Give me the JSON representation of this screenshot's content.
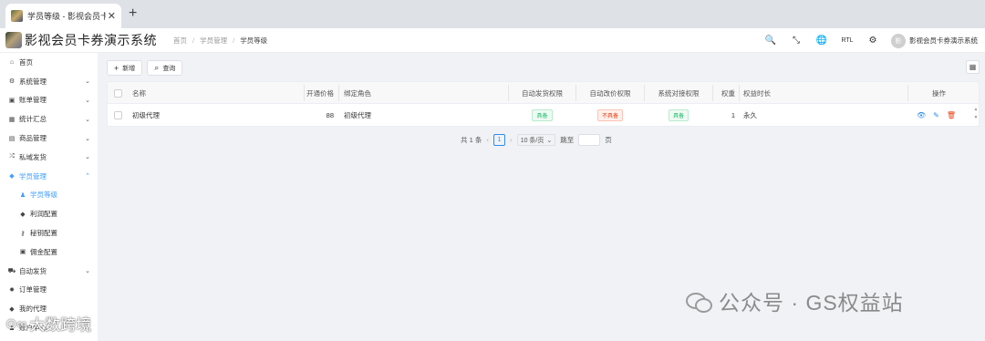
{
  "browser": {
    "tab_title": "学员等级 - 影视会员卡券演示系统",
    "tab_close": "✕",
    "new_tab": "+"
  },
  "header": {
    "app_title": "影视会员卡券演示系统",
    "breadcrumb": [
      "首页",
      "学员管理",
      "学员等级"
    ],
    "breadcrumb_sep": "/",
    "tools": {
      "search": "🔍",
      "fullscreen": "⤡",
      "language": "🌐",
      "rtl": "RTL",
      "settings": "⚙"
    },
    "user": {
      "avatar": "影",
      "name": "影视会员卡券演示系统"
    }
  },
  "sidebar": {
    "items": [
      {
        "icon": "home-icon",
        "glyph": "⌂",
        "label": "首页",
        "chevron": ""
      },
      {
        "icon": "gears-icon",
        "glyph": "⚙",
        "label": "系统管理",
        "chevron": "⌄"
      },
      {
        "icon": "bill-icon",
        "glyph": "▣",
        "label": "账单管理",
        "chevron": "⌄"
      },
      {
        "icon": "stats-icon",
        "glyph": "▦",
        "label": "统计汇总",
        "chevron": "⌄"
      },
      {
        "icon": "calendar-icon",
        "glyph": "▤",
        "label": "商品管理",
        "chevron": "⌄"
      },
      {
        "icon": "shuffle-icon",
        "glyph": "⤮",
        "label": "私域发货",
        "chevron": "⌄"
      },
      {
        "icon": "tag-icon",
        "glyph": "◆",
        "label": "学员管理",
        "chevron": "⌃"
      },
      {
        "icon": "user-icon",
        "glyph": "♟",
        "label": "学员等级",
        "chevron": ""
      },
      {
        "icon": "tag-icon",
        "glyph": "◆",
        "label": "利润配置",
        "chevron": ""
      },
      {
        "icon": "key-icon",
        "glyph": "⚷",
        "label": "秘钥配置",
        "chevron": ""
      },
      {
        "icon": "money-icon",
        "glyph": "▣",
        "label": "佣金配置",
        "chevron": ""
      },
      {
        "icon": "car-icon",
        "glyph": "⛟",
        "label": "自动发货",
        "chevron": "⌄"
      },
      {
        "icon": "gear-icon",
        "glyph": "✹",
        "label": "订单管理",
        "chevron": ""
      },
      {
        "icon": "tag-icon",
        "glyph": "◆",
        "label": "我的代理",
        "chevron": ""
      },
      {
        "icon": "user-icon",
        "glyph": "♟",
        "label": "账户中心",
        "chevron": ""
      }
    ]
  },
  "toolbar": {
    "add_label": "新增",
    "add_glyph": "+",
    "query_label": "查询",
    "query_glyph": "⌕",
    "grid_glyph": "▦"
  },
  "table": {
    "columns": {
      "name": "名称",
      "price": "开通价格",
      "role": "绑定角色",
      "auto_ship": "自动发货权限",
      "auto_price": "自动改价权限",
      "sys_dock": "系统对接权限",
      "weight": "权重",
      "duration": "权益时长",
      "ops": "操作"
    },
    "rows": [
      {
        "name": "初级代理",
        "price": "88",
        "role": "初级代理",
        "auto_ship": "具备",
        "auto_price": "不具备",
        "sys_dock": "具备",
        "weight": "1",
        "duration": "永久"
      }
    ],
    "actions": {
      "view": "👁",
      "edit": "✎",
      "delete": "🗑"
    }
  },
  "pagination": {
    "total": "共 1 条",
    "prev": "‹",
    "current": "1",
    "next": "›",
    "page_size": "10 条/页",
    "page_size_chevron": "⌄",
    "jump_label": "跳至",
    "page_suffix": "页"
  },
  "watermarks": {
    "right": "公众号 · GS权益站",
    "left": "大数跨境",
    "left_glyph": "⊙∞"
  },
  "colors": {
    "primary": "#409eff",
    "success": "#19be6b",
    "danger": "#ed4014",
    "link": "#2d8cf0"
  }
}
